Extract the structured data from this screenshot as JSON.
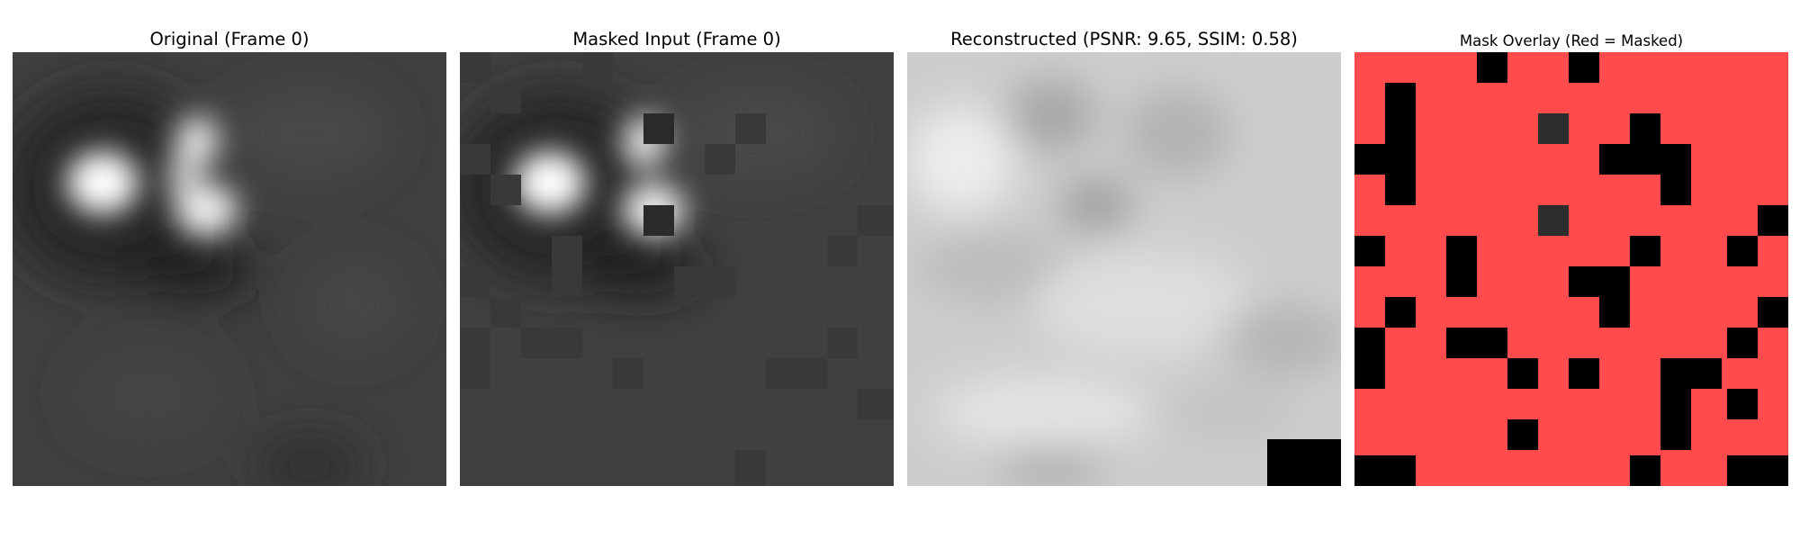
{
  "panels": [
    {
      "title": "Original (Frame 0)"
    },
    {
      "title": "Masked Input (Frame 0)"
    },
    {
      "title": "Reconstructed (PSNR: 9.65, SSIM: 0.58)"
    },
    {
      "title": "Mask Overlay (Red = Masked)"
    }
  ],
  "colors": {
    "background": "#ffffff",
    "mask_red": "#ff4b4b",
    "dark_patch": "#000000"
  }
}
